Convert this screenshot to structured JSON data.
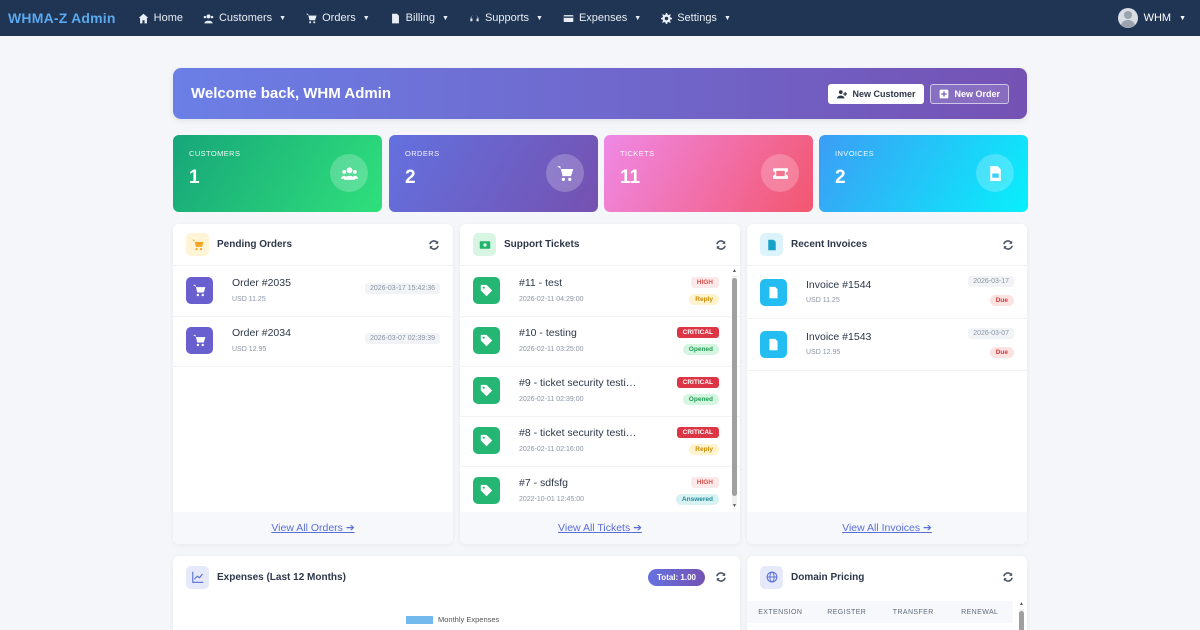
{
  "navbar": {
    "brand": "WHMA-Z Admin",
    "items": [
      {
        "label": "Home",
        "icon": "home-icon",
        "caret": false
      },
      {
        "label": "Customers",
        "icon": "users-icon",
        "caret": true
      },
      {
        "label": "Orders",
        "icon": "cart-icon",
        "caret": true
      },
      {
        "label": "Billing",
        "icon": "file-invoice-icon",
        "caret": true
      },
      {
        "label": "Supports",
        "icon": "headset-icon",
        "caret": true
      },
      {
        "label": "Expenses",
        "icon": "money-icon",
        "caret": true
      },
      {
        "label": "Settings",
        "icon": "gear-icon",
        "caret": true
      }
    ],
    "user": "WHM"
  },
  "welcome": {
    "title": "Welcome back, WHM Admin",
    "new_customer": "New Customer",
    "new_order": "New Order"
  },
  "stats": [
    {
      "label": "CUSTOMERS",
      "value": "1",
      "icon": "users-icon"
    },
    {
      "label": "ORDERS",
      "value": "2",
      "icon": "cart-icon"
    },
    {
      "label": "TICKETS",
      "value": "11",
      "icon": "ticket-icon"
    },
    {
      "label": "INVOICES",
      "value": "2",
      "icon": "file-invoice-icon"
    }
  ],
  "pending_orders": {
    "title": "Pending Orders",
    "rows": [
      {
        "title": "Order #2035",
        "sub": "USD 11.25",
        "date": "2026-03-17 15:42:36"
      },
      {
        "title": "Order #2034",
        "sub": "USD 12.95",
        "date": "2026-03-07 02:39:39"
      }
    ],
    "footer": "View All Orders"
  },
  "support_tickets": {
    "title": "Support Tickets",
    "rows": [
      {
        "title": "#11 - test",
        "sub": "2026-02-11 04:29:00",
        "priority": "HIGH",
        "status": "Reply"
      },
      {
        "title": "#10 - testing",
        "sub": "2026-02-11 03:25:00",
        "priority": "CRITICAL",
        "status": "Opened"
      },
      {
        "title": "#9 - ticket security testi…",
        "sub": "2026-02-11 02:39:00",
        "priority": "CRITICAL",
        "status": "Opened"
      },
      {
        "title": "#8 - ticket security testi…",
        "sub": "2026-02-11 02:16:00",
        "priority": "CRITICAL",
        "status": "Reply"
      },
      {
        "title": "#7 - sdfsfg",
        "sub": "2022-10-01 12:45:00",
        "priority": "HIGH",
        "status": "Answered"
      }
    ],
    "footer": "View All Tickets"
  },
  "recent_invoices": {
    "title": "Recent Invoices",
    "rows": [
      {
        "title": "Invoice #1544",
        "sub": "USD 11.25",
        "date": "2026-03-17",
        "status": "Due"
      },
      {
        "title": "Invoice #1543",
        "sub": "USD 12.95",
        "date": "2026-03-07",
        "status": "Due"
      }
    ],
    "footer": "View All Invoices"
  },
  "expenses": {
    "title": "Expenses (Last 12 Months)",
    "total": "Total: 1.00",
    "legend": "Monthly Expenses"
  },
  "domain_pricing": {
    "title": "Domain Pricing",
    "columns": [
      "EXTENSION",
      "REGISTER",
      "TRANSFER",
      "RENEWAL"
    ]
  },
  "colors": {
    "navbar": "#1f3553",
    "brand": "#5aa8ee",
    "link": "#5a6fd8",
    "critical": "#dc3545"
  }
}
